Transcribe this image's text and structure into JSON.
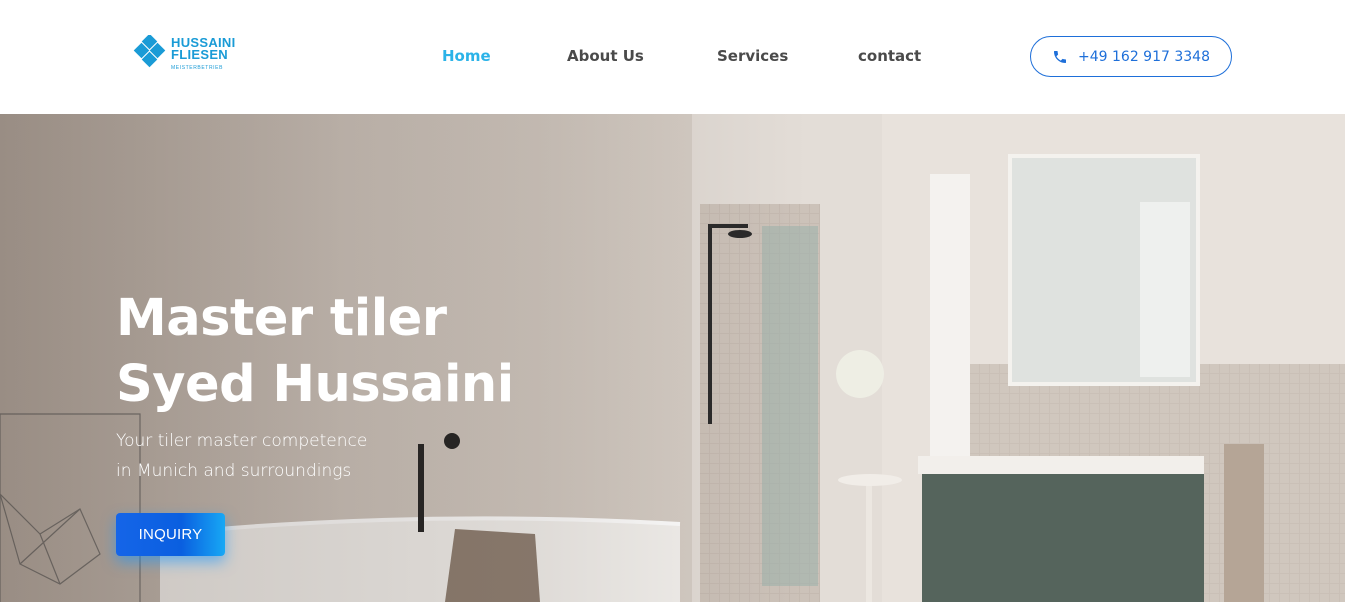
{
  "brand": {
    "name_line1": "HUSSAINI",
    "name_line2": "FLIESEN",
    "tagline": "MEISTERBETRIEB",
    "color": "#1a9bd6"
  },
  "nav": {
    "items": [
      {
        "label": "Home",
        "active": true
      },
      {
        "label": "About Us",
        "active": false
      },
      {
        "label": "Services",
        "active": false
      },
      {
        "label": "contact",
        "active": false
      }
    ],
    "active_color": "#2bb3e8"
  },
  "phone": {
    "icon": "phone-icon",
    "number": "+49 162 917 3348",
    "color": "#1e6fd9"
  },
  "hero": {
    "title_line1": "Master tiler",
    "title_line2": "Syed Hussaini",
    "subtitle_line1": "Your tiler master competence",
    "subtitle_line2": "in Munich and surroundings",
    "cta_label": "INQUIRY"
  }
}
